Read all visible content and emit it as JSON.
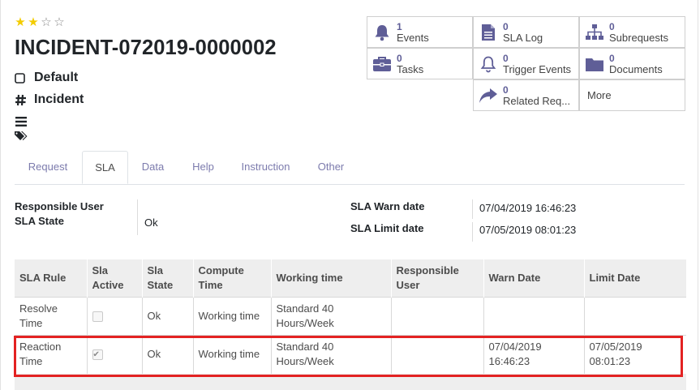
{
  "rating": {
    "filled": 2,
    "total": 4
  },
  "record": {
    "title": "INCIDENT-072019-0000002",
    "kind": "Default",
    "type": "Incident"
  },
  "buttons": {
    "events": {
      "count": "1",
      "label": "Events",
      "icon": "bell-icon"
    },
    "sla_log": {
      "count": "0",
      "label": "SLA Log",
      "icon": "document-icon"
    },
    "subrequests": {
      "count": "0",
      "label": "Subrequests",
      "icon": "sitemap-icon"
    },
    "tasks": {
      "count": "0",
      "label": "Tasks",
      "icon": "briefcase-icon"
    },
    "trigger_events": {
      "count": "0",
      "label": "Trigger Events",
      "icon": "bell-outline-icon"
    },
    "documents": {
      "count": "0",
      "label": "Documents",
      "icon": "folder-icon"
    },
    "related": {
      "count": "0",
      "label": "Related Req...",
      "icon": "share-arrow-icon"
    },
    "more": {
      "label": "More"
    }
  },
  "tabs": [
    "Request",
    "SLA",
    "Data",
    "Help",
    "Instruction",
    "Other"
  ],
  "active_tab": "SLA",
  "fields": {
    "responsible_user_label": "Responsible User",
    "sla_state_label": "SLA State",
    "sla_state_value": "Ok",
    "sla_warn_label": "SLA Warn date",
    "sla_warn_value": "07/04/2019 16:46:23",
    "sla_limit_label": "SLA Limit date",
    "sla_limit_value": "07/05/2019 08:01:23"
  },
  "sla_table": {
    "headers": [
      "SLA Rule",
      "Sla Active",
      "Sla State",
      "Compute Time",
      "Working time",
      "Responsible User",
      "Warn Date",
      "Limit Date"
    ],
    "rows": [
      {
        "rule": "Resolve Time",
        "active": false,
        "state": "Ok",
        "compute": "Working time",
        "working": "Standard 40 Hours/Week",
        "responsible": "",
        "warn": "",
        "limit": ""
      },
      {
        "rule": "Reaction Time",
        "active": true,
        "state": "Ok",
        "compute": "Working time",
        "working": "Standard 40 Hours/Week",
        "responsible": "",
        "warn": "07/04/2019 16:46:23",
        "limit": "07/05/2019 08:01:23"
      }
    ]
  },
  "colors": {
    "accent": "#5f5e97",
    "tab_link": "#7c7bad",
    "star": "#f3cc00",
    "highlight": "#e32222"
  }
}
